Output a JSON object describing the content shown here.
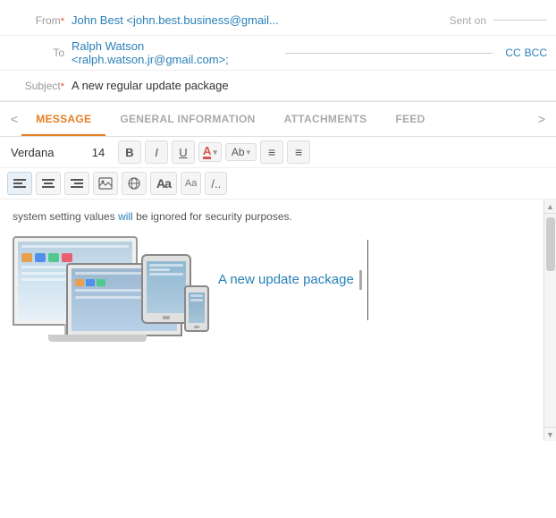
{
  "header": {
    "from_label": "From",
    "from_required": "*",
    "from_value": "John Best <john.best.business@gmail...",
    "sent_on_label": "Sent on",
    "to_label": "To",
    "to_value": "Ralph Watson <ralph.watson.jr@gmail.com>;",
    "cc_label": "CC",
    "bcc_label": "BCC",
    "subject_label": "Subject",
    "subject_required": "*",
    "subject_value": "A new regular update package"
  },
  "tabs": {
    "items": [
      {
        "label": "MESSAGE",
        "active": true
      },
      {
        "label": "GENERAL INFORMATION",
        "active": false
      },
      {
        "label": "ATTACHMENTS",
        "active": false
      },
      {
        "label": "FEED",
        "active": false
      }
    ],
    "prev_arrow": "<",
    "next_arrow": ">"
  },
  "toolbar": {
    "font_name": "Verdana",
    "font_size": "14",
    "bold": "B",
    "italic": "I",
    "underline": "U",
    "color_label": "A",
    "ab_label": "Ab",
    "list_ordered": "≡",
    "list_unordered": "≡"
  },
  "toolbar2": {
    "align_left": "≡",
    "align_center": "≡",
    "align_right": "≡",
    "image_icon": "🖼",
    "globe_icon": "🌐",
    "aa_big": "Aa",
    "aa_small": "Aa",
    "slash": "/.."
  },
  "content": {
    "security_text": "system setting values will be ignored for security purposes.",
    "will_word": "will",
    "update_title": "A new update package",
    "cursor_visible": true
  },
  "colors": {
    "accent": "#e67e22",
    "link": "#2980b9",
    "border": "#ddd",
    "text_muted": "#aaa",
    "tab_inactive": "#aaa",
    "required": "#e74c3c"
  }
}
